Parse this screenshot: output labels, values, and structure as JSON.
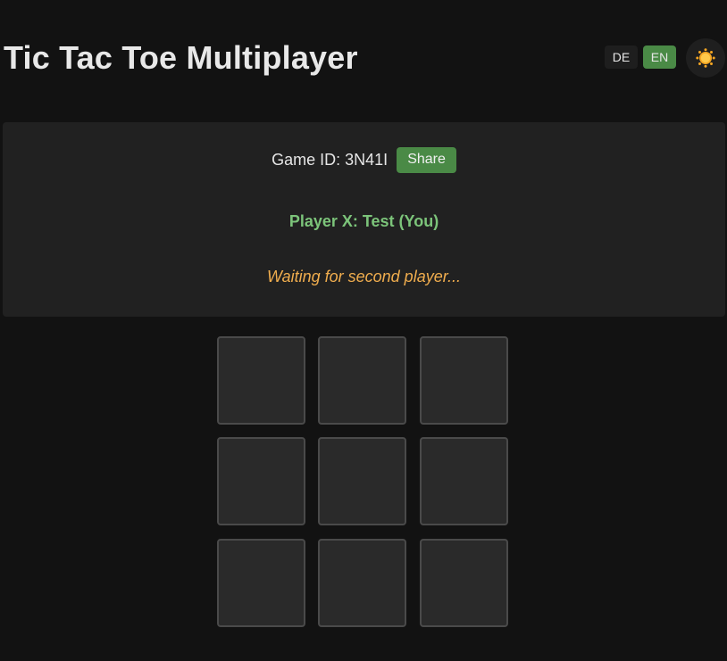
{
  "header": {
    "title": "Tic Tac Toe Multiplayer",
    "languages": [
      {
        "code": "DE",
        "active": false
      },
      {
        "code": "EN",
        "active": true
      }
    ],
    "theme_toggle_icon": "sun-icon"
  },
  "game": {
    "id_label": "Game ID:",
    "id_value": "3N41I",
    "share_label": "Share",
    "player_line": "Player X: Test (You)",
    "status": "Waiting for second player..."
  },
  "board": {
    "cells": [
      "",
      "",
      "",
      "",
      "",
      "",
      "",
      "",
      ""
    ]
  },
  "colors": {
    "background": "#121212",
    "panel": "#212121",
    "accent_green": "#4a8a46",
    "player_text": "#7cc47a",
    "waiting_text": "#f0ad4e",
    "cell_fill": "#2a2a2a",
    "cell_border": "#4a4a4a",
    "sun": "#f5a623"
  }
}
